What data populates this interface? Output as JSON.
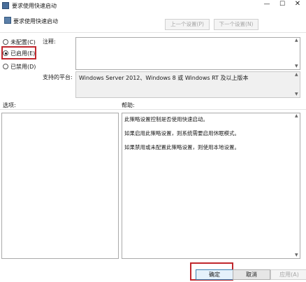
{
  "window": {
    "title": "要求使用快速启动",
    "minimize_glyph": "—",
    "maximize_glyph": "☐",
    "close_glyph": "✕"
  },
  "header": {
    "title": "要求使用快速启动",
    "prev_label": "上一个设置(P)",
    "next_label": "下一个设置(N)"
  },
  "state": {
    "options": [
      {
        "label": "未配置(C)",
        "checked": false
      },
      {
        "label": "已启用(E)",
        "checked": true
      },
      {
        "label": "已禁用(D)",
        "checked": false
      }
    ]
  },
  "comment": {
    "label": "注释:",
    "value": ""
  },
  "platform": {
    "label": "支持的平台:",
    "value": "Windows Server 2012、Windows 8 或 Windows RT 及以上版本"
  },
  "options_section": {
    "label": "选项:"
  },
  "help_section": {
    "label": "帮助:",
    "lines": [
      "此策略设置控制是否使用快速启动。",
      "如果启用此策略设置，则系统需要启用休眠模式。",
      "如果禁用或未配置此策略设置，则使用本地设置。"
    ]
  },
  "buttons": {
    "ok": "确定",
    "cancel": "取消",
    "apply": "应用(A)"
  },
  "colors": {
    "highlight": "#c0272d",
    "accent": "#3c7fb1"
  },
  "icons": {
    "up_arrow": "▲",
    "down_arrow": "▼"
  }
}
